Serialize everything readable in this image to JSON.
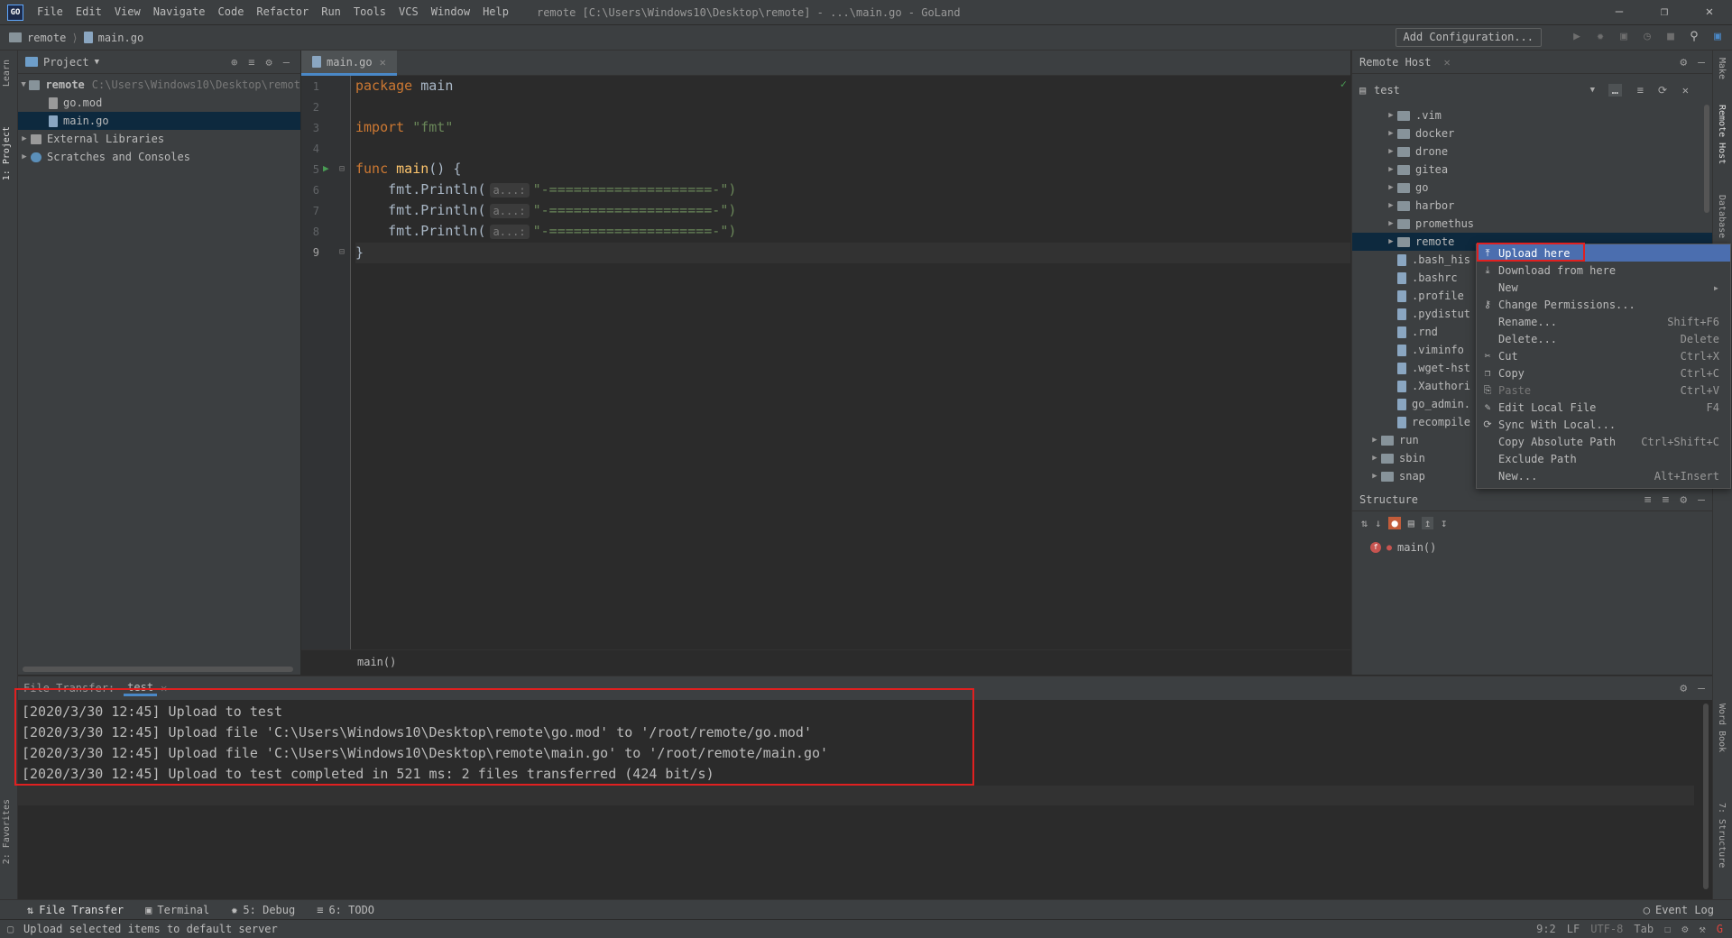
{
  "titlebar": {
    "logo": "GO",
    "menu": [
      "File",
      "Edit",
      "View",
      "Navigate",
      "Code",
      "Refactor",
      "Run",
      "Tools",
      "VCS",
      "Window",
      "Help"
    ],
    "window_title": "remote [C:\\Users\\Windows10\\Desktop\\remote] - ...\\main.go - GoLand"
  },
  "navbar": {
    "crumbs": [
      "remote",
      "main.go"
    ],
    "add_configuration": "Add Configuration..."
  },
  "left_stripe": {
    "tab1": "Learn",
    "tab2": "1: Project",
    "tab3": "2: Favorites"
  },
  "project": {
    "header": "Project",
    "tree": [
      {
        "label": "remote",
        "hint": "C:\\Users\\Windows10\\Desktop\\remot",
        "bold": true
      },
      {
        "label": "go.mod"
      },
      {
        "label": "main.go"
      },
      {
        "label": "External Libraries"
      },
      {
        "label": "Scratches and Consoles"
      }
    ]
  },
  "editor": {
    "tab": "main.go",
    "lines": [
      "1",
      "2",
      "3",
      "4",
      "5",
      "6",
      "7",
      "8",
      "9"
    ],
    "code": {
      "l1_kw": "package",
      "l1_id": "main",
      "l3_kw": "import",
      "l3_str": "\"fmt\"",
      "l5_kw": "func",
      "l5_fn": "main",
      "l5_rest": "() {",
      "println": "fmt.Println(",
      "hint": "a...:",
      "arg": "\"-====================-\")",
      "l9": "}"
    },
    "footer": "main()"
  },
  "remote_host": {
    "header": "Remote Host",
    "server": "test",
    "items": [
      {
        "label": ".vim",
        "type": "folder",
        "level": 1
      },
      {
        "label": "docker",
        "type": "folder",
        "level": 1
      },
      {
        "label": "drone",
        "type": "folder",
        "level": 1
      },
      {
        "label": "gitea",
        "type": "folder",
        "level": 1
      },
      {
        "label": "go",
        "type": "folder",
        "level": 1
      },
      {
        "label": "harbor",
        "type": "folder",
        "level": 1
      },
      {
        "label": "promethus",
        "type": "folder",
        "level": 1
      },
      {
        "label": "remote",
        "type": "folder",
        "level": 1
      },
      {
        "label": ".bash_his",
        "type": "file",
        "level": 1
      },
      {
        "label": ".bashrc",
        "type": "file",
        "level": 1
      },
      {
        "label": ".profile",
        "type": "file",
        "level": 1
      },
      {
        "label": ".pydistut",
        "type": "file",
        "level": 1
      },
      {
        "label": ".rnd",
        "type": "file",
        "level": 1
      },
      {
        "label": ".viminfo",
        "type": "file",
        "level": 1
      },
      {
        "label": ".wget-hst",
        "type": "file",
        "level": 1
      },
      {
        "label": ".Xauthori",
        "type": "file",
        "level": 1
      },
      {
        "label": "go_admin.",
        "type": "file",
        "level": 1
      },
      {
        "label": "recompile",
        "type": "file",
        "level": 1
      },
      {
        "label": "run",
        "type": "folder",
        "level": 0
      },
      {
        "label": "sbin",
        "type": "folder",
        "level": 0
      },
      {
        "label": "snap",
        "type": "folder",
        "level": 0
      }
    ]
  },
  "context_menu": [
    {
      "label": "Upload here",
      "shortcut": "",
      "selected": true,
      "icon": "upload-icon"
    },
    {
      "label": "Download from here",
      "shortcut": "",
      "icon": "download-icon"
    },
    {
      "label": "New",
      "shortcut": "▸"
    },
    {
      "label": "Change Permissions...",
      "shortcut": "",
      "icon": "key-icon"
    },
    {
      "label": "Rename...",
      "shortcut": "Shift+F6"
    },
    {
      "label": "Delete...",
      "shortcut": "Delete"
    },
    {
      "label": "Cut",
      "shortcut": "Ctrl+X",
      "icon": "scissors-icon"
    },
    {
      "label": "Copy",
      "shortcut": "Ctrl+C",
      "icon": "copy-icon"
    },
    {
      "label": "Paste",
      "shortcut": "Ctrl+V",
      "disabled": true,
      "icon": "paste-icon"
    },
    {
      "label": "Edit Local File",
      "shortcut": "F4",
      "icon": "pencil-icon"
    },
    {
      "label": "Sync With Local...",
      "shortcut": "",
      "icon": "sync-icon"
    },
    {
      "label": "Copy Absolute Path",
      "shortcut": "Ctrl+Shift+C"
    },
    {
      "label": "Exclude Path",
      "shortcut": ""
    },
    {
      "label": "New...",
      "shortcut": "Alt+Insert"
    }
  ],
  "structure": {
    "header": "Structure",
    "item": "main()"
  },
  "right_stripe": {
    "tab1": "Make",
    "tab2": "Remote Host",
    "tab3": "Database",
    "tab4": "Word Book",
    "tab5": "7: Structure"
  },
  "bottom": {
    "tab_group": "File Transfer:",
    "tab": "test",
    "log": [
      "[2020/3/30 12:45] Upload to test",
      "[2020/3/30 12:45] Upload file 'C:\\Users\\Windows10\\Desktop\\remote\\go.mod' to '/root/remote/go.mod'",
      "[2020/3/30 12:45] Upload file 'C:\\Users\\Windows10\\Desktop\\remote\\main.go' to '/root/remote/main.go'",
      "[2020/3/30 12:45] Upload to test completed in 521 ms: 2 files transferred (424 bit/s)"
    ]
  },
  "toolwindows": [
    "File Transfer",
    "Terminal",
    "5: Debug",
    "6: TODO"
  ],
  "event_log": "Event Log",
  "status": {
    "message": "Upload selected items to default server",
    "position": "9:2",
    "line_sep": "LF",
    "encoding": "UTF-8",
    "indent": "Tab"
  },
  "colors": {
    "accent": "#4b6eaf",
    "highlight_box": "#e02020",
    "bg": "#2b2b2b",
    "panel": "#3c3f41"
  }
}
